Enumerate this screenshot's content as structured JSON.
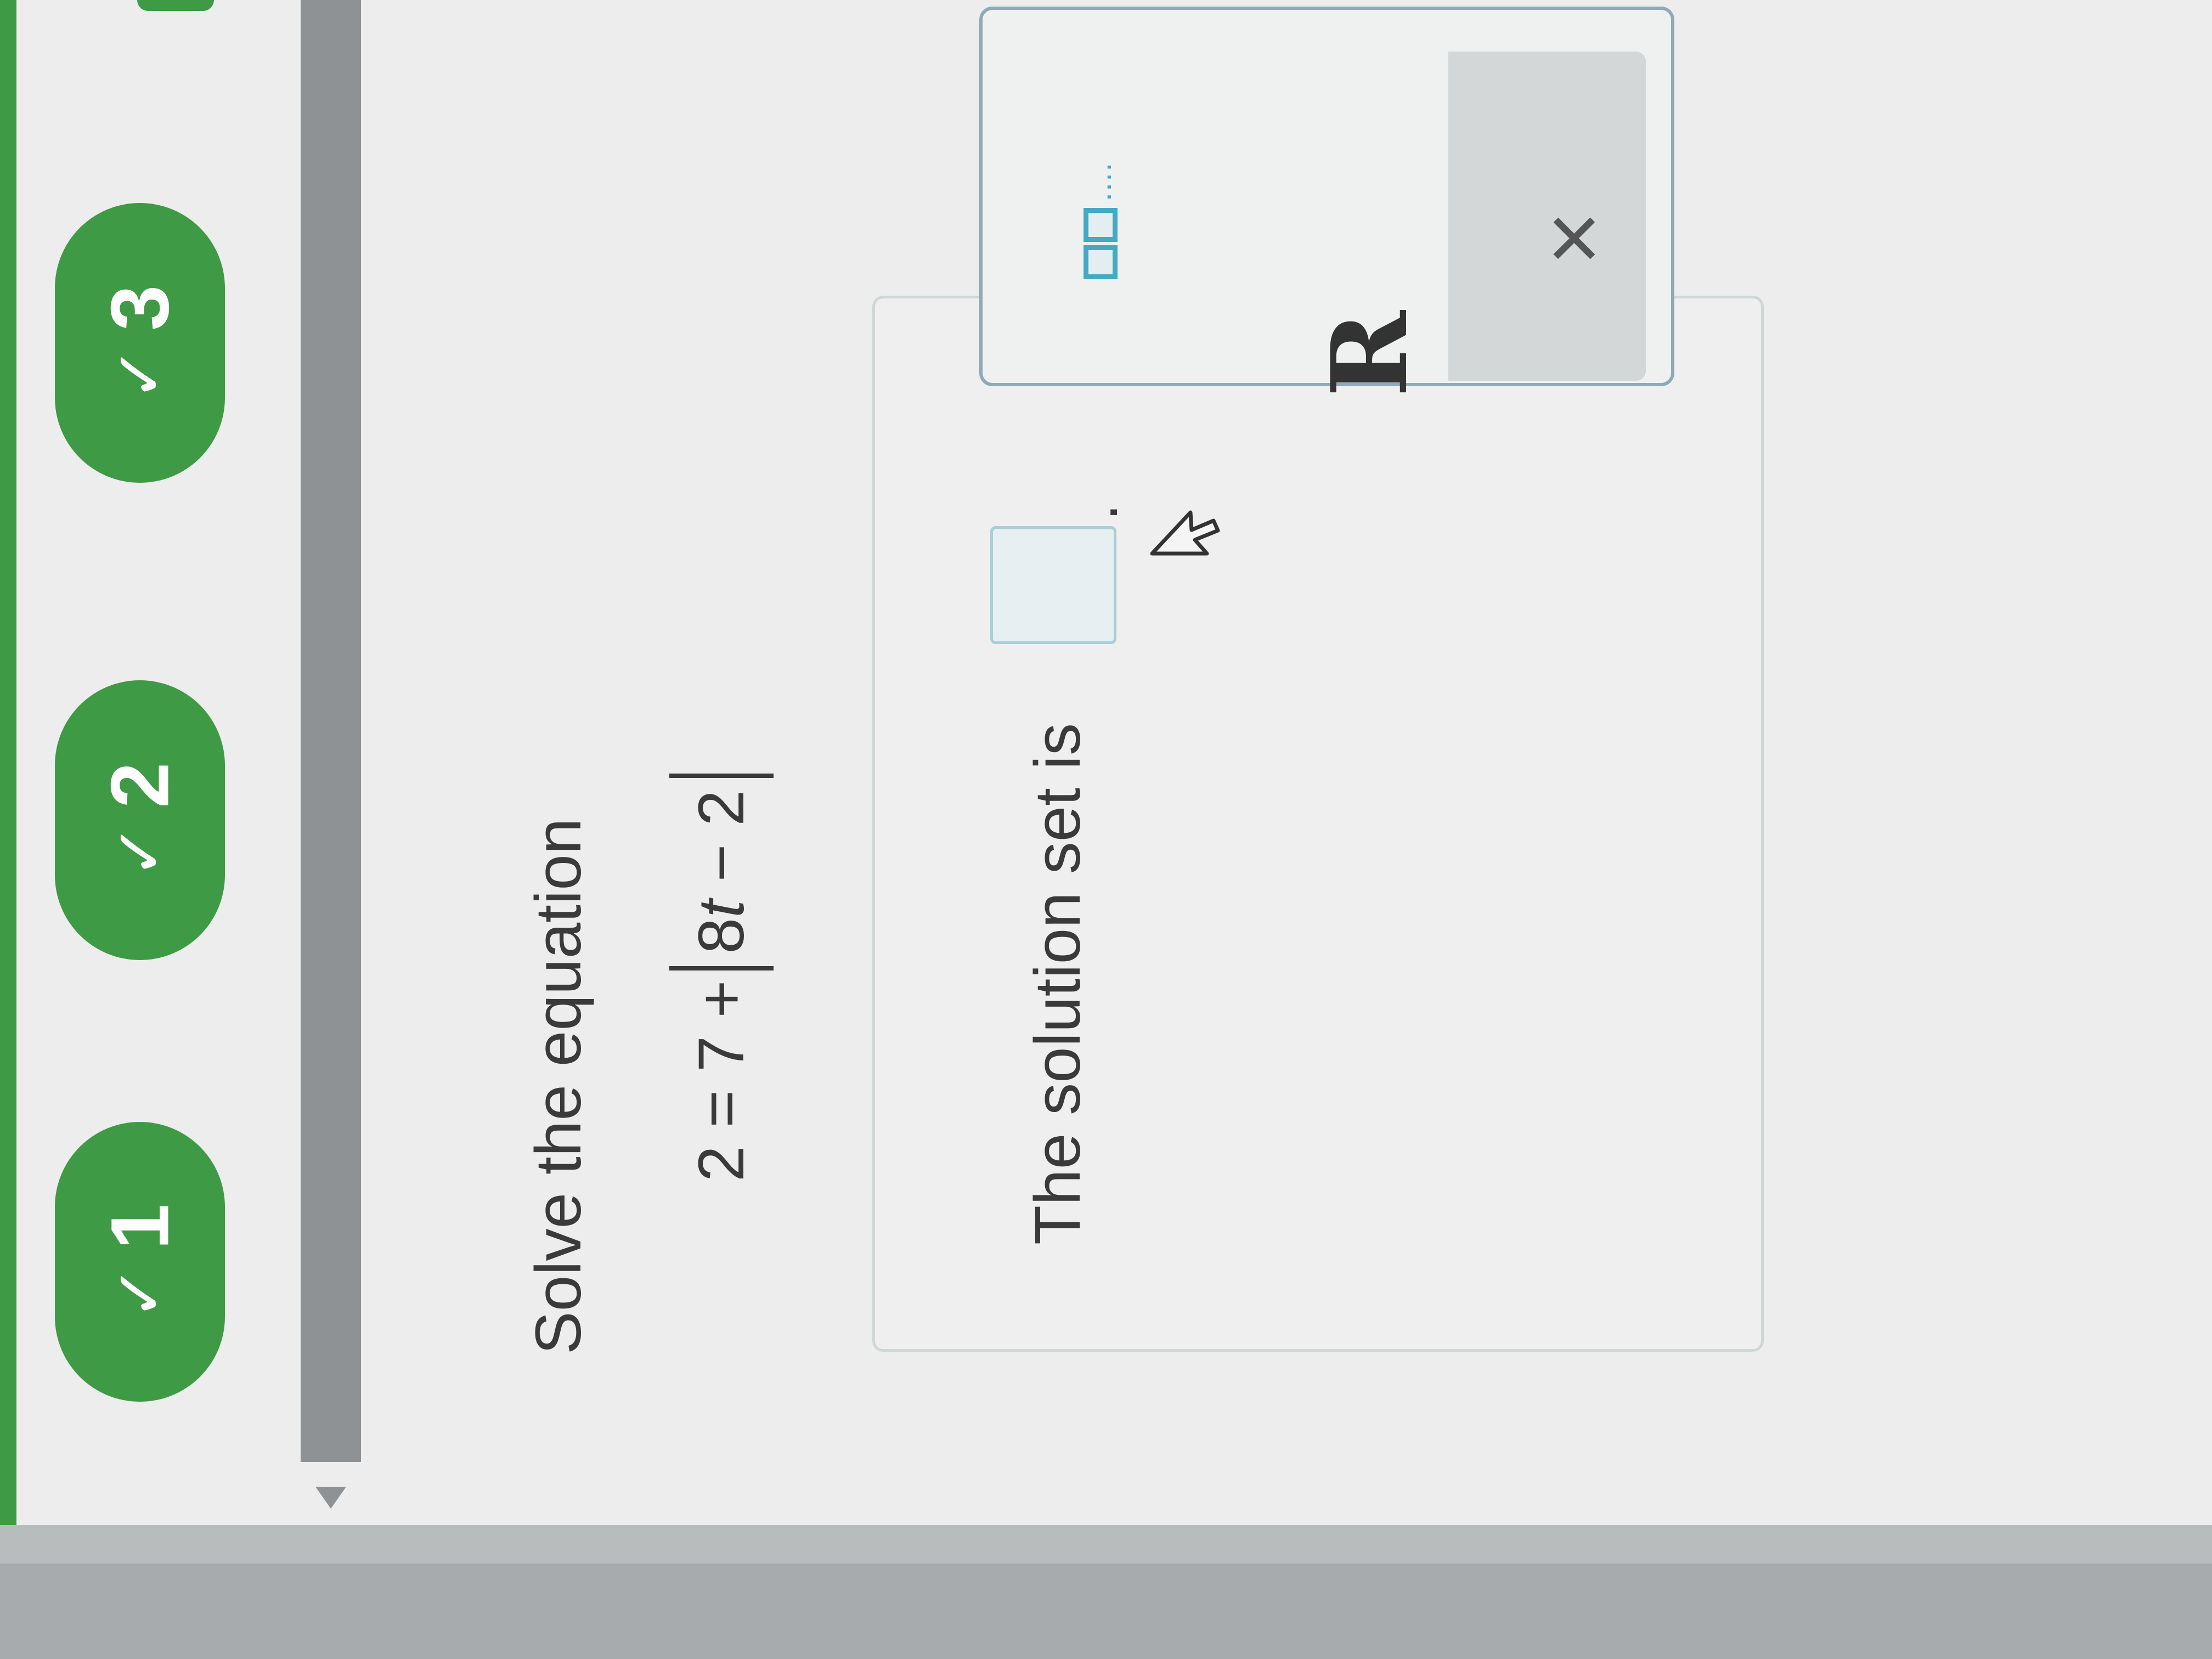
{
  "nav": {
    "questions": [
      {
        "check": "✓",
        "label": "1"
      },
      {
        "check": "✓",
        "label": "2"
      },
      {
        "check": "✓",
        "label": "3"
      }
    ]
  },
  "question": {
    "prompt": "Solve the equation",
    "equation": {
      "left": "2 = 7 +",
      "abs_coeff": "8",
      "abs_var": "t",
      "abs_rest": " − 2"
    }
  },
  "answer": {
    "label": "The solution set is",
    "value": "",
    "trailing": "."
  },
  "palette": {
    "set_icon_dots": "....",
    "real_numbers_symbol": "R",
    "close_symbol": "×"
  },
  "colors": {
    "accent_green": "#3f9a46",
    "palette_blue": "#46a8c3"
  }
}
